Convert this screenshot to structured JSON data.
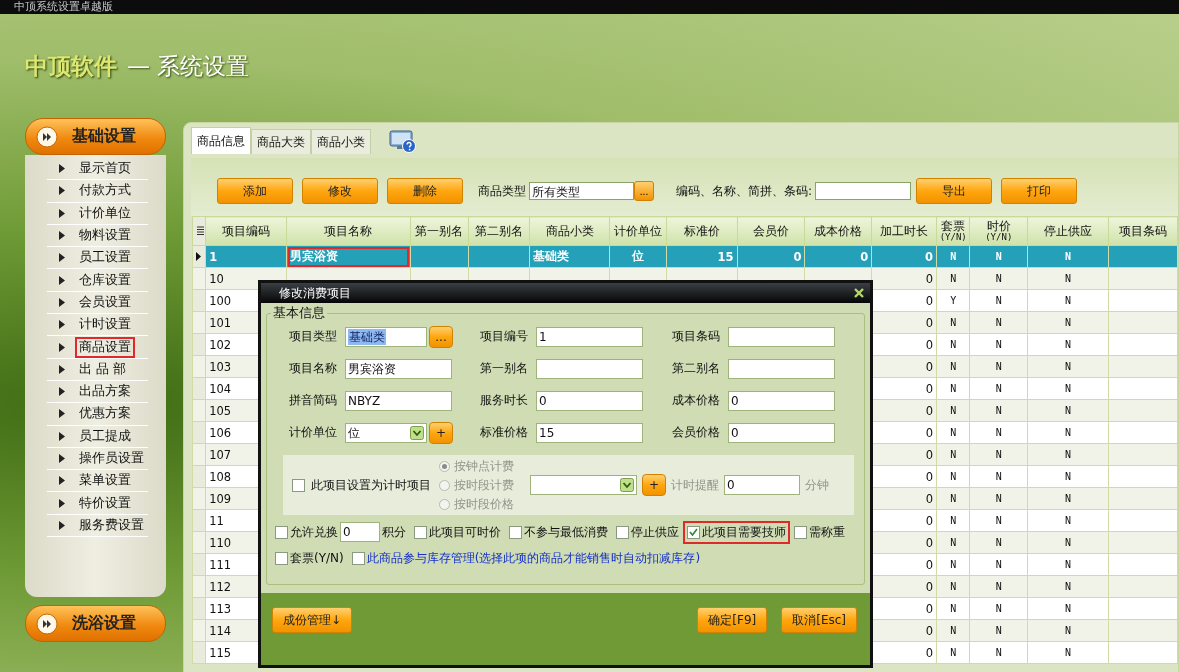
{
  "window": {
    "title": "中顶系统设置卓越版"
  },
  "header": {
    "brand": "中顶软件",
    "title": "— 系统设置"
  },
  "sidebar": {
    "groups": [
      {
        "label": "基础设置",
        "items": [
          {
            "label": "显示首页",
            "marked": false
          },
          {
            "label": "付款方式",
            "marked": false
          },
          {
            "label": "计价单位",
            "marked": false
          },
          {
            "label": "物料设置",
            "marked": false
          },
          {
            "label": "员工设置",
            "marked": false
          },
          {
            "label": "仓库设置",
            "marked": false
          },
          {
            "label": "会员设置",
            "marked": false
          },
          {
            "label": "计时设置",
            "marked": false
          },
          {
            "label": "商品设置",
            "marked": true
          },
          {
            "label": "出 品 部",
            "marked": false
          },
          {
            "label": "出品方案",
            "marked": false
          },
          {
            "label": "优惠方案",
            "marked": false
          },
          {
            "label": "员工提成",
            "marked": false
          },
          {
            "label": "操作员设置",
            "marked": false
          },
          {
            "label": "菜单设置",
            "marked": false
          },
          {
            "label": "特价设置",
            "marked": false
          },
          {
            "label": "服务费设置",
            "marked": false
          }
        ]
      },
      {
        "label": "洗浴设置"
      }
    ]
  },
  "tabs": [
    {
      "label": "商品信息",
      "selected": true
    },
    {
      "label": "商品大类",
      "selected": false
    },
    {
      "label": "商品小类",
      "selected": false
    }
  ],
  "toolbar": {
    "buttons_left": [
      "添加",
      "修改",
      "删除"
    ],
    "type_label": "商品类型",
    "type_value": "所有类型",
    "type_button": "...",
    "search_label": "编码、名称、简拼、条码:",
    "buttons_right": [
      "导出",
      "打印"
    ]
  },
  "table": {
    "columns": [
      {
        "label": "项目编码"
      },
      {
        "label": "项目名称"
      },
      {
        "label": "第一别名"
      },
      {
        "label": "第二别名"
      },
      {
        "label": "商品小类"
      },
      {
        "label": "计价单位"
      },
      {
        "label": "标准价"
      },
      {
        "label": "会员价"
      },
      {
        "label": "成本价格"
      },
      {
        "label": "加工时长"
      },
      {
        "label": "套票",
        "sub": "(Y/N)"
      },
      {
        "label": "时价",
        "sub": "(Y/N)"
      },
      {
        "label": "停止供应"
      },
      {
        "label": "项目条码"
      }
    ],
    "rows": [
      {
        "selected": true,
        "marked": true,
        "code": "1",
        "name": "男宾浴资",
        "subcategory": "基础类",
        "unit": "位",
        "std_price": "15",
        "member_price": "0",
        "cost_price": "0",
        "process_time": "0",
        "combo": "N",
        "time_price": "N",
        "stop_supply": "N"
      },
      {
        "selected": false,
        "code": "10",
        "process_time": "0",
        "combo": "N",
        "time_price": "N",
        "stop_supply": "N"
      },
      {
        "selected": false,
        "code": "100",
        "process_time": "0",
        "combo": "Y",
        "time_price": "N",
        "stop_supply": "N"
      },
      {
        "selected": false,
        "code": "101",
        "process_time": "0",
        "combo": "N",
        "time_price": "N",
        "stop_supply": "N"
      },
      {
        "selected": false,
        "code": "102",
        "process_time": "0",
        "combo": "N",
        "time_price": "N",
        "stop_supply": "N"
      },
      {
        "selected": false,
        "code": "103",
        "process_time": "0",
        "combo": "N",
        "time_price": "N",
        "stop_supply": "N"
      },
      {
        "selected": false,
        "code": "104",
        "process_time": "0",
        "combo": "N",
        "time_price": "N",
        "stop_supply": "N"
      },
      {
        "selected": false,
        "code": "105",
        "process_time": "0",
        "combo": "N",
        "time_price": "N",
        "stop_supply": "N"
      },
      {
        "selected": false,
        "code": "106",
        "process_time": "0",
        "combo": "N",
        "time_price": "N",
        "stop_supply": "N"
      },
      {
        "selected": false,
        "code": "107",
        "process_time": "0",
        "combo": "N",
        "time_price": "N",
        "stop_supply": "N"
      },
      {
        "selected": false,
        "code": "108",
        "process_time": "0",
        "combo": "N",
        "time_price": "N",
        "stop_supply": "N"
      },
      {
        "selected": false,
        "code": "109",
        "process_time": "0",
        "combo": "N",
        "time_price": "N",
        "stop_supply": "N"
      },
      {
        "selected": false,
        "code": "11",
        "process_time": "0",
        "combo": "N",
        "time_price": "N",
        "stop_supply": "N"
      },
      {
        "selected": false,
        "code": "110",
        "process_time": "0",
        "combo": "N",
        "time_price": "N",
        "stop_supply": "N"
      },
      {
        "selected": false,
        "code": "111",
        "process_time": "0",
        "combo": "N",
        "time_price": "N",
        "stop_supply": "N"
      },
      {
        "selected": false,
        "code": "112",
        "process_time": "0",
        "combo": "N",
        "time_price": "N",
        "stop_supply": "N"
      },
      {
        "selected": false,
        "code": "113",
        "process_time": "0",
        "combo": "N",
        "time_price": "N",
        "stop_supply": "N"
      },
      {
        "selected": false,
        "code": "114",
        "process_time": "0",
        "combo": "N",
        "time_price": "N",
        "stop_supply": "N"
      },
      {
        "selected": false,
        "code": "115",
        "process_time": "0",
        "combo": "N",
        "time_price": "N",
        "stop_supply": "N"
      }
    ]
  },
  "dialog": {
    "title": "修改消费项目",
    "group_label": "基本信息",
    "fields": [
      {
        "kind": "picker",
        "label": "项目类型",
        "value": "基础类",
        "highlighted": true,
        "button": "..."
      },
      {
        "kind": "text",
        "label": "项目编号",
        "value": "1"
      },
      {
        "kind": "text",
        "label": "项目条码"
      },
      {
        "kind": "text",
        "label": "项目名称",
        "value": "男宾浴资"
      },
      {
        "kind": "text",
        "label": "第一别名"
      },
      {
        "kind": "text",
        "label": "第二别名"
      },
      {
        "kind": "text",
        "label": "拼音简码",
        "value": "NBYZ"
      },
      {
        "kind": "text",
        "label": "服务时长",
        "value": "0"
      },
      {
        "kind": "text",
        "label": "成本价格",
        "value": "0"
      },
      {
        "kind": "select",
        "label": "计价单位",
        "value": "位",
        "button": "+"
      },
      {
        "kind": "text",
        "label": "标准价格",
        "value": "15"
      },
      {
        "kind": "text",
        "label": "会员价格",
        "value": "0"
      }
    ],
    "timed": {
      "label": "此项目设置为计时项目",
      "checked": false,
      "disabled": true,
      "radios": [
        {
          "label": "按钟点计费",
          "selected": true
        },
        {
          "label": "按时段计费",
          "selected": false
        },
        {
          "label": "按时段价格",
          "selected": false
        }
      ],
      "select_button": "+",
      "remind_label": "计时提醒",
      "remind_value": "0",
      "unit": "分钟"
    },
    "option_rows": [
      {
        "items": [
          {
            "kind": "points",
            "label": "允许兑换",
            "checked": false,
            "marked": false,
            "value": "0",
            "suffix": "积分"
          },
          {
            "kind": "check",
            "label": "此项目可时价",
            "checked": false,
            "marked": false
          },
          {
            "kind": "check",
            "label": "不参与最低消费",
            "checked": false,
            "marked": false
          },
          {
            "kind": "check",
            "label": "停止供应",
            "checked": false,
            "marked": false
          },
          {
            "kind": "check",
            "label": "此项目需要技师",
            "checked": true,
            "marked": true
          },
          {
            "kind": "check",
            "label": "需称重",
            "checked": false,
            "marked": false
          }
        ]
      },
      {
        "items": [
          {
            "kind": "check",
            "label": "套票(Y/N)",
            "checked": false,
            "marked": false
          },
          {
            "kind": "link",
            "label": "此商品参与库存管理(选择此项的商品才能销售时自动扣减库存)",
            "checked": false,
            "marked": false
          }
        ]
      }
    ],
    "left_button": "成份管理↓",
    "right_buttons": [
      "确定[F9]",
      "取消[Esc]"
    ]
  }
}
